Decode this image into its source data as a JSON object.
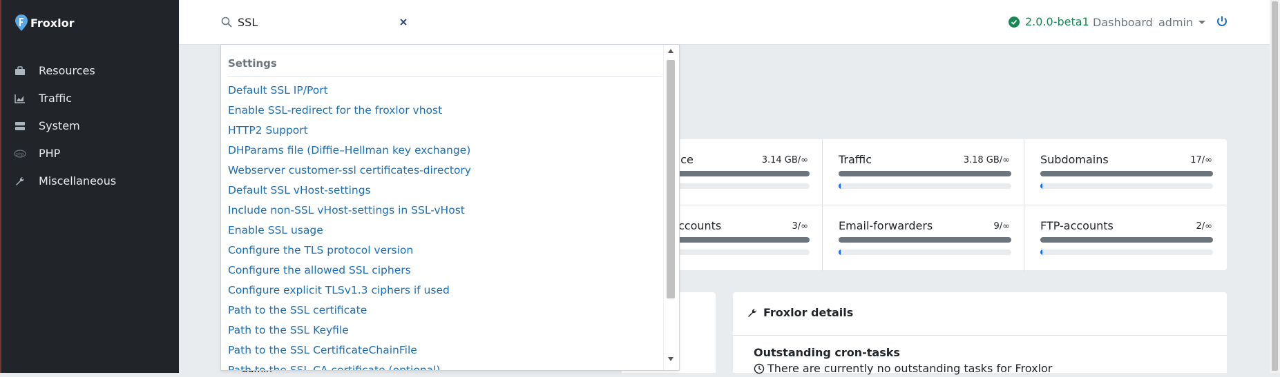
{
  "app": {
    "brand": "Froxlor"
  },
  "sidebar": {
    "items": [
      {
        "label": "Resources",
        "icon": "resources-icon"
      },
      {
        "label": "Traffic",
        "icon": "traffic-chart-icon"
      },
      {
        "label": "System",
        "icon": "server-icon"
      },
      {
        "label": "PHP",
        "icon": "php-icon"
      },
      {
        "label": "Miscellaneous",
        "icon": "wrench-icon"
      }
    ]
  },
  "topbar": {
    "search_value": "SSL",
    "version": "2.0.0-beta1",
    "dashboard_label": "Dashboard",
    "user_label": "admin"
  },
  "search_dropdown": {
    "section_title": "Settings",
    "results": [
      "Default SSL IP/Port",
      "Enable SSL-redirect for the froxlor vhost",
      "HTTP2 Support",
      "DHParams file (Diffie–Hellman key exchange)",
      "Webserver customer-ssl certificates-directory",
      "Default SSL vHost-settings",
      "Include non-SSL vHost-settings in SSL-vHost",
      "Enable SSL usage",
      "Configure the TLS protocol version",
      "Configure the allowed SSL ciphers",
      "Configure explicit TLSv1.3 ciphers if used",
      "Path to the SSL certificate",
      "Path to the SSL Keyfile",
      "Path to the SSL CertificateChainFile",
      "Path to the SSL CA certificate (optional)"
    ]
  },
  "stats": {
    "cells": [
      {
        "label": "Webspace",
        "value": "3.14 GB/∞",
        "fill": 0.04
      },
      {
        "label": "Traffic",
        "value": "3.18 GB/∞",
        "fill": 0.01
      },
      {
        "label": "Subdomains",
        "value": "17/∞",
        "fill": 0.01
      },
      {
        "label": "Email-accounts",
        "value": "3/∞",
        "fill": 0.04
      },
      {
        "label": "Email-forwarders",
        "value": "9/∞",
        "fill": 0.01
      },
      {
        "label": "FTP-accounts",
        "value": "2/∞",
        "fill": 0.01
      }
    ]
  },
  "details_panel": {
    "title": "Froxlor details",
    "subtitle": "Outstanding cron-tasks",
    "message": "There are currently no outstanding tasks for Froxlor"
  },
  "left_panel": {
    "partial_text": "admin"
  },
  "colors": {
    "sidebar_bg": "#212529",
    "link": "#1d6fb5",
    "success": "#198754",
    "primary": "#0d6efd"
  }
}
